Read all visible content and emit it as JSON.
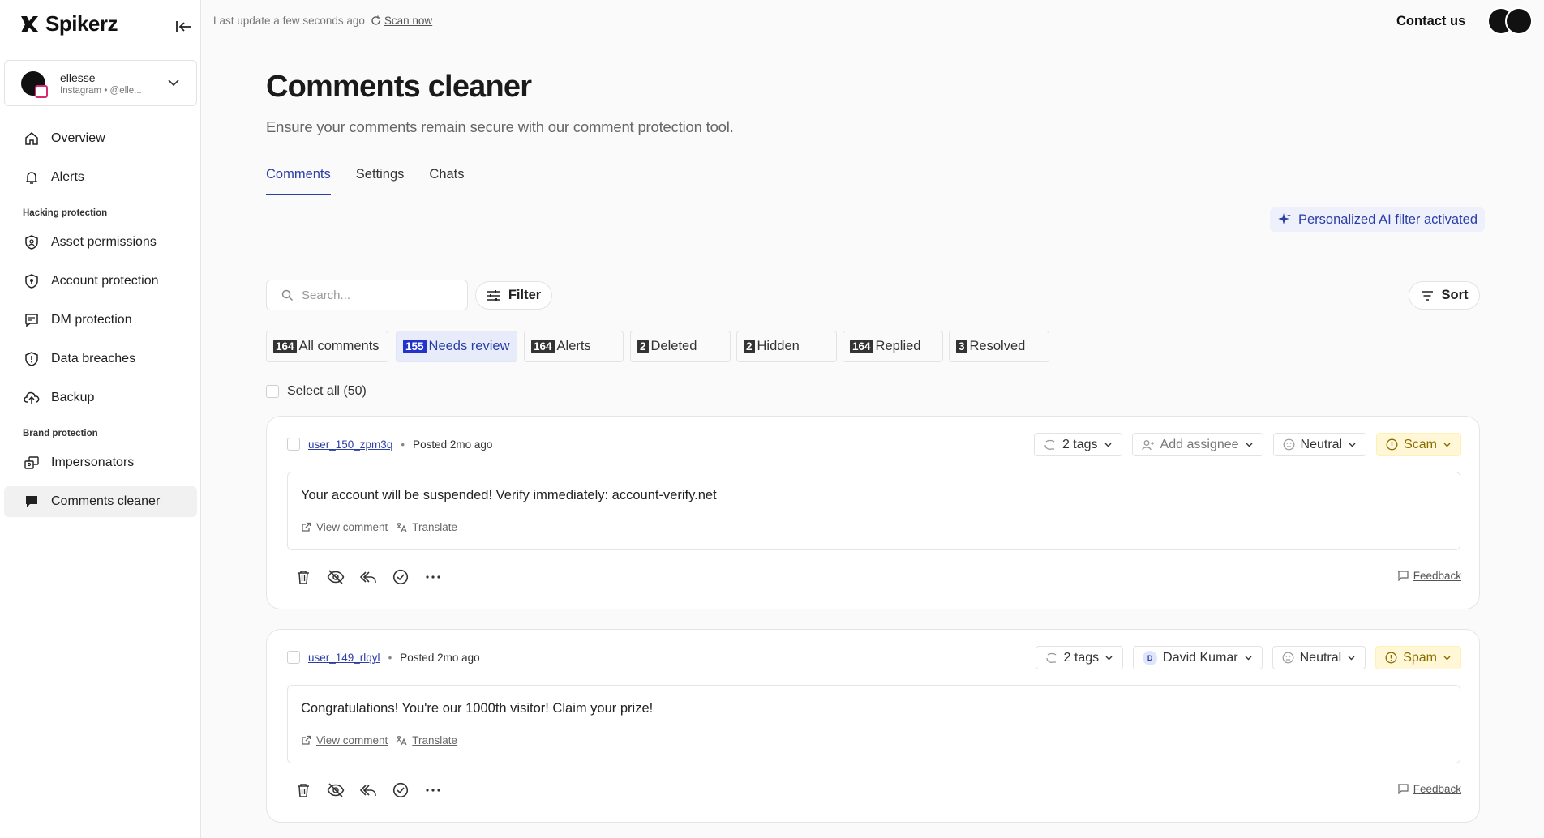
{
  "brand": {
    "name": "Spikerz"
  },
  "account": {
    "name": "ellesse",
    "sub": "Instagram • @elle..."
  },
  "nav": {
    "overview": "Overview",
    "alerts": "Alerts",
    "section_hacking": "Hacking protection",
    "asset_permissions": "Asset permissions",
    "account_protection": "Account protection",
    "dm_protection": "DM protection",
    "data_breaches": "Data breaches",
    "backup": "Backup",
    "section_brand": "Brand protection",
    "impersonators": "Impersonators",
    "comments_cleaner": "Comments cleaner"
  },
  "topbar": {
    "status": "Last update a few seconds ago",
    "scan": "Scan now",
    "contact": "Contact us"
  },
  "page": {
    "title": "Comments cleaner",
    "subtitle": "Ensure your comments remain secure with our comment protection tool."
  },
  "tabs": [
    "Comments",
    "Settings",
    "Chats"
  ],
  "ai_badge": "Personalized AI filter activated",
  "search": {
    "placeholder": "Search..."
  },
  "filter_label": "Filter",
  "sort_label": "Sort",
  "chips": [
    {
      "count": "164",
      "label": "All comments"
    },
    {
      "count": "155",
      "label": "Needs review"
    },
    {
      "count": "164",
      "label": "Alerts"
    },
    {
      "count": "2",
      "label": "Deleted"
    },
    {
      "count": "2",
      "label": "Hidden"
    },
    {
      "count": "164",
      "label": "Replied"
    },
    {
      "count": "3",
      "label": "Resolved"
    }
  ],
  "select_all": "Select all (50)",
  "comments": [
    {
      "user": "user_150_zpm3q",
      "posted": "Posted 2mo ago",
      "tags": "2 tags",
      "assignee": "Add assignee",
      "sentiment": "Neutral",
      "category": "Scam",
      "text": "Your account will be suspended! Verify immediately: account-verify.net",
      "view": "View comment",
      "translate": "Translate",
      "feedback": "Feedback"
    },
    {
      "user": "user_149_rlqyl",
      "posted": "Posted 2mo ago",
      "tags": "2 tags",
      "assignee": "David Kumar",
      "assignee_initial": "D",
      "sentiment": "Neutral",
      "category": "Spam",
      "text": "Congratulations! You're our 1000th visitor! Claim your prize!",
      "view": "View comment",
      "translate": "Translate",
      "feedback": "Feedback"
    }
  ],
  "colors": {
    "accent": "#2b3ea6",
    "active_chip": "#e8ecfa",
    "warn": "#fff7d6"
  }
}
